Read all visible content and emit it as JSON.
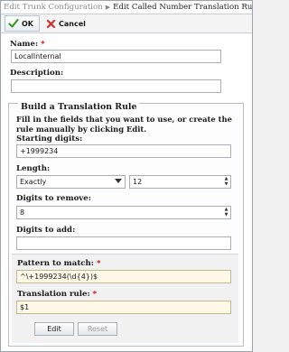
{
  "breadcrumb": {
    "parent": "Edit Trunk Configuration",
    "current": "Edit Called Number Translation Rule - LocalInternal"
  },
  "toolbar": {
    "ok_label": "OK",
    "cancel_label": "Cancel"
  },
  "form": {
    "name_label": "Name:",
    "name_value": "LocalInternal",
    "description_label": "Description:",
    "description_value": ""
  },
  "builder": {
    "title": "Build a Translation Rule",
    "instructions": "Fill in the fields that you want to use, or create the rule manually by clicking Edit.",
    "starting_digits_label": "Starting digits:",
    "starting_digits_value": "+1999234",
    "length_label": "Length:",
    "length_mode": "Exactly",
    "length_value": "12",
    "digits_remove_label": "Digits to remove:",
    "digits_remove_value": "8",
    "digits_add_label": "Digits to add:",
    "digits_add_value": "",
    "pattern_label": "Pattern to match:",
    "pattern_value": "^\\+1999234(\\d{4})$",
    "rule_label": "Translation rule:",
    "rule_value": "$1",
    "edit_label": "Edit",
    "reset_label": "Reset"
  },
  "colors": {
    "required": "#cc0000",
    "ok_check": "#3a9a2a",
    "cancel_x": "#d03030",
    "highlight_field": "#fdf9e6"
  },
  "icons": {
    "ok": "checkmark-icon",
    "cancel": "x-icon"
  }
}
